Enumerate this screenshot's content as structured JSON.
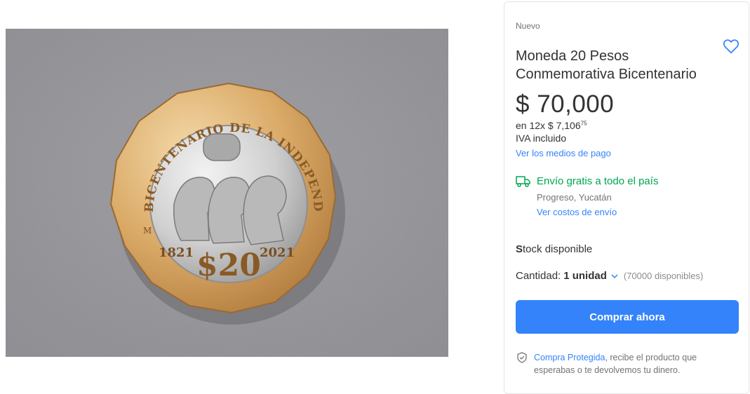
{
  "product_image": {
    "coin_top_legend": "BICENTENARIO DE LA INDEPENDENCIA NACIONAL",
    "coin_year_left": "1821",
    "coin_year_right": "2021",
    "coin_value": "$20",
    "coin_mintmark": "M"
  },
  "details": {
    "condition": "Nuevo",
    "title": "Moneda 20 Pesos Conmemorativa Bicentenario",
    "price": "$ 70,000",
    "installments_prefix": "en 12x $ 7,106",
    "installments_cents": "75",
    "iva": "IVA incluido",
    "payment_link": "Ver los medios de pago",
    "shipping": "Envío gratis a todo el país",
    "location": "Progreso, Yucatán",
    "shipping_link": "Ver costos de envío",
    "stock_bold": "S",
    "stock_rest": "tock disponible",
    "quantity_label": "Cantidad:",
    "quantity_value": "1 unidad",
    "quantity_available": "(70000 disponibles)",
    "buy_button": "Comprar ahora",
    "protect_link": "Compra Protegida",
    "protect_text": ", recibe el producto que esperabas o te devolvemos tu dinero."
  },
  "colors": {
    "accent": "#3483fa",
    "shipping_green": "#00a650",
    "text": "#333333",
    "muted": "#737373"
  }
}
